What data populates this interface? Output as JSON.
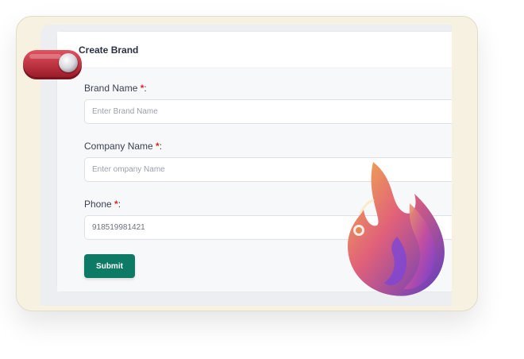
{
  "form": {
    "title": "Create Brand",
    "fields": [
      {
        "label": "Brand Name",
        "required_mark": "*",
        "suffix": ":",
        "placeholder": "Enter Brand Name",
        "value": ""
      },
      {
        "label": "Company Name",
        "required_mark": "*",
        "suffix": ":",
        "placeholder": "Enter ompany Name",
        "value": ""
      },
      {
        "label": "Phone",
        "required_mark": "*",
        "suffix": ":",
        "placeholder": "",
        "value": "918519981421"
      }
    ],
    "submit_label": "Submit"
  },
  "decorations": {
    "toggle_icon": "toggle-switch-icon",
    "flame_icon": "flame-icon"
  },
  "colors": {
    "submit_bg": "#0d7a66",
    "required": "#e02424",
    "frame_bg": "#f7f1e1",
    "toggle": "#c42a3a"
  }
}
